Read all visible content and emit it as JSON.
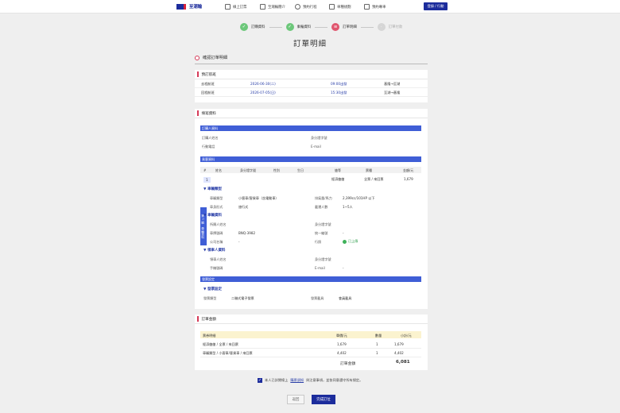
{
  "nav": {
    "logo": "至潮輪",
    "items": [
      "線上訂票",
      "至潮輪簡介",
      "預約行程",
      "車種規劃",
      "預約專車"
    ],
    "login": "登錄 / 行動"
  },
  "steps": [
    {
      "label": "訂購資料",
      "state": "done"
    },
    {
      "label": "乘輪資料",
      "state": "done"
    },
    {
      "label": "訂單明細",
      "state": "current"
    },
    {
      "label": "訂單付款",
      "state": "future"
    }
  ],
  "page_title": "訂單明細",
  "section_heading": "確認訂單明細",
  "flights": {
    "heading": "預訂航班",
    "rows": [
      {
        "label": "去程航班",
        "date": "2026-06-30(二)",
        "time": "09:00出發",
        "route": "基隆→至湖"
      },
      {
        "label": "回程航班",
        "date": "2026-07-05(日)",
        "time": "15:30出發",
        "route": "至湖→基隆"
      }
    ]
  },
  "details": {
    "heading": "填寫資料",
    "buyer_bar": "訂購人資料",
    "buyer": {
      "name_label": "訂購人姓名",
      "id_label": "身分證字號",
      "phone_label": "行動電話",
      "email_label": "E-mail"
    },
    "passenger_bar": "乘客資料",
    "table_headers": [
      "#",
      "姓名",
      "身分證字號",
      "性別",
      "生日",
      "艙等",
      "票種",
      "金額/元"
    ],
    "row1": {
      "index": "1",
      "class": "經濟艙艙",
      "ticket": "全票 / 來回票",
      "amount": "1,679"
    },
    "side_label_a": "第 1 輛",
    "side_label_b": "車輛資料",
    "vehicle_type_title": "▼ 車輛類型",
    "vehicle_type_label": "車輛類型",
    "vehicle_type_value": "小客車/客貨車（含電動車）",
    "displacement_label": "排氣量/馬力",
    "displacement_value": "2,399cc/101HP 以下",
    "drive_label": "車身形式",
    "drive_value": "旅行式",
    "seats_label": "載運人數",
    "seats_value": "1~5人",
    "vehicle_data_title": "▼ 車輛資料",
    "owner_label": "所屬人姓名",
    "owner_id_label": "身分證字號",
    "plate_label": "車牌號碼",
    "plate_value": "BNQ-3982",
    "uniform_label": "統一編號",
    "uniform_value": "-",
    "company_label": "公司名稱",
    "company_value": "-",
    "license_label": "行照",
    "license_value": "已上傳",
    "driver_title": "▼ 領車人資料",
    "driver_name_label": "領車人姓名",
    "driver_id_label": "身分證字號",
    "driver_phone_label": "手機號碼",
    "driver_email_label": "E-mail",
    "driver_email_value": "-",
    "invoice_bar": "發票設定",
    "invoice_title": "▼ 發票設定",
    "invoice_type_label": "發票類型",
    "invoice_type_value": "二聯式電子發票",
    "carrier_label": "發票載具",
    "carrier_value": "會員載具"
  },
  "summary": {
    "heading": "訂單金額",
    "headers": [
      "票券明細",
      "單價/元",
      "數量",
      "小計/元"
    ],
    "rows": [
      {
        "item": "經濟艙艙 / 全票 / 來回票",
        "price": "1,679",
        "qty": "1",
        "subtotal": "1,679"
      },
      {
        "item": "車輛類型 / 小客車/客貨車 / 來回票",
        "price": "4,402",
        "qty": "1",
        "subtotal": "4,402"
      }
    ],
    "total_label": "訂單金額",
    "total_value": "6,081"
  },
  "agreement": {
    "prefix": "本人已詳閱線上",
    "link": "購票須知",
    "suffix": "與注意事項，並依同意遵守所有規定。"
  },
  "buttons": {
    "back": "返回",
    "done": "完成訂位"
  },
  "colors": {
    "primary": "#1c2c9c",
    "accent": "#d63a58",
    "bar": "#3f5ed6",
    "success": "#6cc77a",
    "summary_head": "#fbf3cf"
  }
}
